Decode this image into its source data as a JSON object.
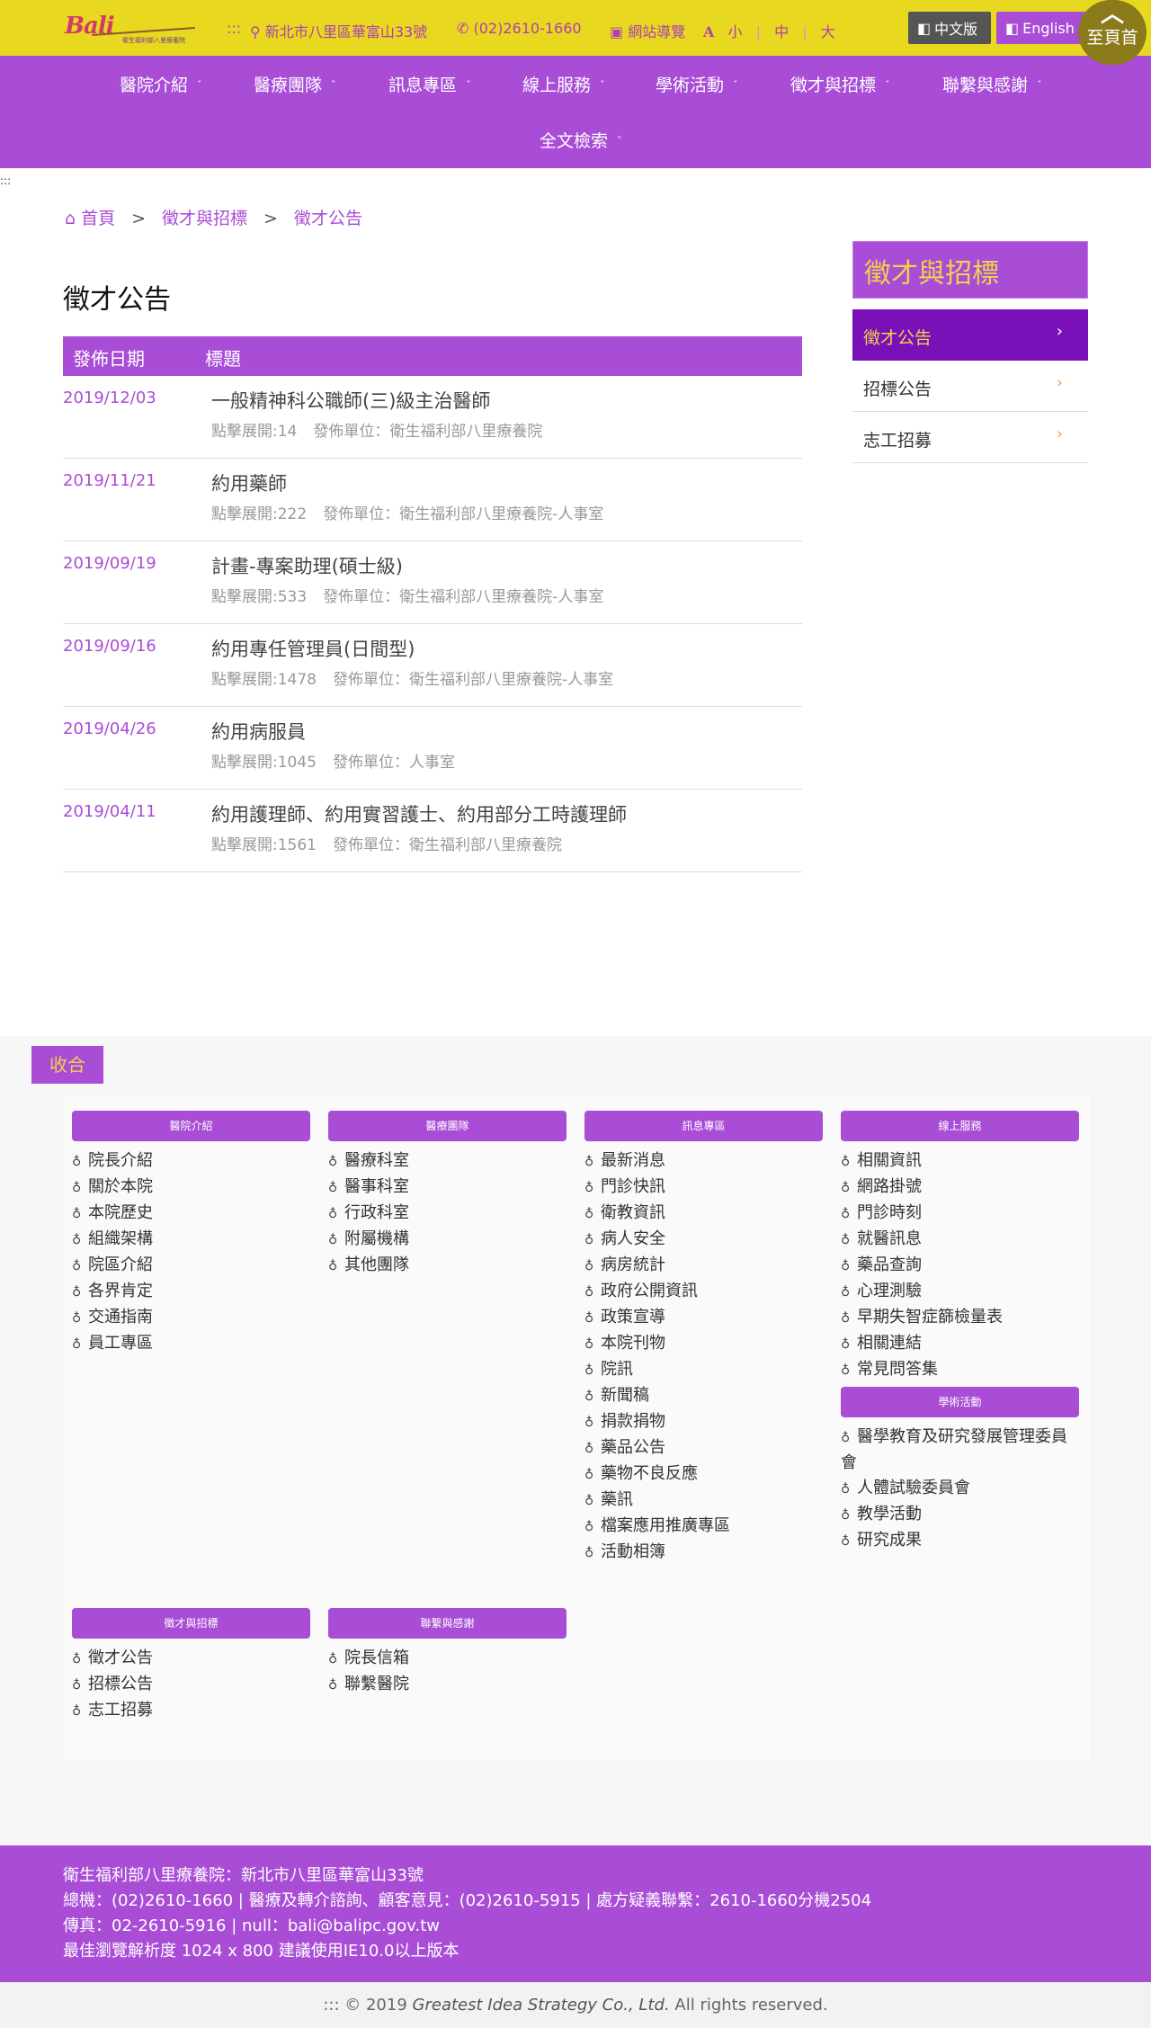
{
  "topbar": {
    "logo_text": "Bali",
    "logo_subtext": "衛生福利部八里療養院",
    "skip_dots": ":::",
    "address": "新北市八里區華富山33號",
    "phone": "(02)2610-1660",
    "sitemap": "網站導覽",
    "font_sizes": [
      "小",
      "中",
      "大"
    ],
    "lang_zh": "中文版",
    "lang_en": "English",
    "to_top": "至頁首"
  },
  "nav": {
    "items": [
      "醫院介紹",
      "醫療團隊",
      "訊息專區",
      "線上服務",
      "學術活動",
      "徵才與招標",
      "聯繫與感謝",
      "全文檢索"
    ]
  },
  "tiny_dots": ":::",
  "breadcrumb": {
    "home": "首頁",
    "level1": "徵才與招標",
    "level2": "徵才公告"
  },
  "page_title": "徵才公告",
  "table": {
    "col_date": "發佈日期",
    "col_title": "標題",
    "rows": [
      {
        "date": "2019/12/03",
        "title": "一般精神科公職師(三)級主治醫師",
        "clicks": "點擊展開:14",
        "unit": "發佈單位：衛生福利部八里療養院"
      },
      {
        "date": "2019/11/21",
        "title": "約用藥師",
        "clicks": "點擊展開:222",
        "unit": "發佈單位：衛生福利部八里療養院-人事室"
      },
      {
        "date": "2019/09/19",
        "title": "計畫-專案助理(碩士級)",
        "clicks": "點擊展開:533",
        "unit": "發佈單位：衛生福利部八里療養院-人事室"
      },
      {
        "date": "2019/09/16",
        "title": "約用專任管理員(日間型)",
        "clicks": "點擊展開:1478",
        "unit": "發佈單位：衛生福利部八里療養院-人事室"
      },
      {
        "date": "2019/04/26",
        "title": "約用病服員",
        "clicks": "點擊展開:1045",
        "unit": "發佈單位：人事室"
      },
      {
        "date": "2019/04/11",
        "title": "約用護理師、約用實習護士、約用部分工時護理師",
        "clicks": "點擊展開:1561",
        "unit": "發佈單位：衛生福利部八里療養院"
      }
    ]
  },
  "side": {
    "title": "徵才與招標",
    "items": [
      "徵才公告",
      "招標公告",
      "志工招募"
    ]
  },
  "sitemap": {
    "collapse": "收合",
    "cols": [
      {
        "head": "醫院介紹",
        "links": [
          "院長介紹",
          "關於本院",
          "本院歷史",
          "組織架構",
          "院區介紹",
          "各界肯定",
          "交通指南",
          "員工專區"
        ]
      },
      {
        "head": "醫療團隊",
        "links": [
          "醫療科室",
          "醫事科室",
          "行政科室",
          "附屬機構",
          "其他團隊"
        ]
      },
      {
        "head": "訊息專區",
        "links": [
          "最新消息",
          "門診快訊",
          "衛教資訊",
          "病人安全",
          "病房統計",
          "政府公開資訊",
          "政策宣導",
          "本院刊物",
          "院訊",
          "新聞稿",
          "捐款捐物",
          "藥品公告",
          "藥物不良反應",
          "藥訊",
          "檔案應用推廣專區",
          "活動相簿"
        ]
      },
      {
        "head": "線上服務",
        "links": [
          "相關資訊",
          "網路掛號",
          "門診時刻",
          "就醫訊息",
          "藥品查詢",
          "心理測驗",
          "早期失智症篩檢量表",
          "相關連結",
          "常見問答集"
        ]
      },
      {
        "head": "學術活動",
        "links": [
          "醫學教育及研究發展管理委員會",
          "人體試驗委員會",
          "教學活動",
          "研究成果"
        ]
      },
      {
        "head": "徵才與招標",
        "links": [
          "徵才公告",
          "招標公告",
          "志工招募"
        ]
      },
      {
        "head": "聯繫與感謝",
        "links": [
          "院長信箱",
          "聯繫醫院"
        ]
      }
    ]
  },
  "footer": {
    "line1": "衛生福利部八里療養院：新北市八里區華富山33號",
    "line2": "總機：(02)2610-1660 | 醫療及轉介諮詢、顧客意見：(02)2610-5915 | 處方疑義聯繫：2610-1660分機2504",
    "line3": "傳真：02-2610-5916 | null：bali@balipc.gov.tw",
    "line4": "最佳瀏覽解析度 1024 x 800 建議使用IE10.0以上版本"
  },
  "copyright": {
    "prefix": "::: © 2019",
    "company": "Greatest Idea Strategy Co., Ltd.",
    "suffix": "All rights reserved."
  }
}
